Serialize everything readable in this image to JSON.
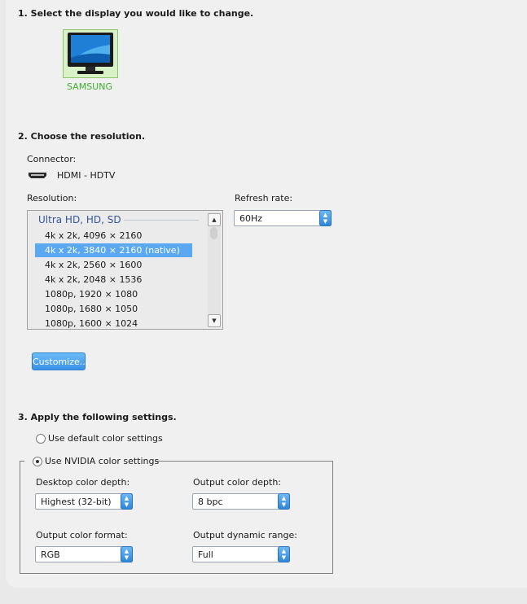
{
  "section1": {
    "heading": "1. Select the display you would like to change."
  },
  "display": {
    "name": "SAMSUNG",
    "icon": "monitor-icon"
  },
  "section2": {
    "heading": "2. Choose the resolution."
  },
  "connector": {
    "label": "Connector:",
    "value": "HDMI - HDTV",
    "icon": "hdmi-port-icon"
  },
  "resolution": {
    "label": "Resolution:",
    "group": "Ultra HD, HD, SD",
    "items": [
      "4k x 2k, 4096 × 2160",
      "4k x 2k, 3840 × 2160 (native)",
      "4k x 2k, 2560 × 1600",
      "4k x 2k, 2048 × 1536",
      "1080p, 1920 × 1080",
      "1080p, 1680 × 1050",
      "1080p, 1600 × 1024"
    ],
    "selected_index": 1
  },
  "refresh": {
    "label": "Refresh rate:",
    "value": "60Hz"
  },
  "customize_label": "Customize...",
  "section3": {
    "heading": "3. Apply the following settings."
  },
  "color": {
    "default_label": "Use default color settings",
    "nvidia_label": "Use NVIDIA color settings",
    "selected": "nvidia",
    "desktop_depth": {
      "label": "Desktop color depth:",
      "value": "Highest (32-bit)"
    },
    "output_depth": {
      "label": "Output color depth:",
      "value": "8 bpc"
    },
    "output_format": {
      "label": "Output color format:",
      "value": "RGB"
    },
    "dynamic_range": {
      "label": "Output dynamic range:",
      "value": "Full"
    }
  },
  "colors": {
    "accent": "#5aa8f2",
    "display_selected_bg": "#d8f1c6",
    "display_name": "#3db12a"
  }
}
